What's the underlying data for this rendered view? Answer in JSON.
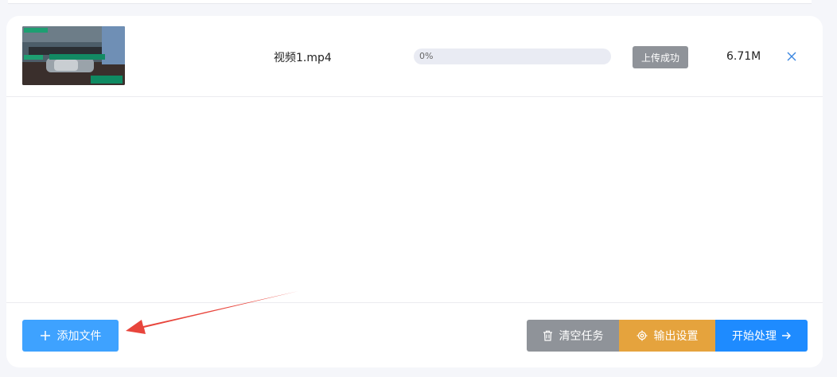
{
  "file_row": {
    "thumbnail_icon": "video-thumbnail",
    "filename": "视频1.mp4",
    "progress_text": "0%",
    "progress_value": 0,
    "status": "上传成功",
    "size": "6.71M",
    "remove_icon": "close-icon"
  },
  "footer": {
    "add_label": "添加文件",
    "clear_label": "清空任务",
    "settings_label": "输出设置",
    "start_label": "开始处理"
  },
  "colors": {
    "add": "#3ea2ff",
    "clear": "#8f9399",
    "settings": "#e5a33d",
    "start": "#1e8bff",
    "annotation_arrow": "#e8453c"
  }
}
